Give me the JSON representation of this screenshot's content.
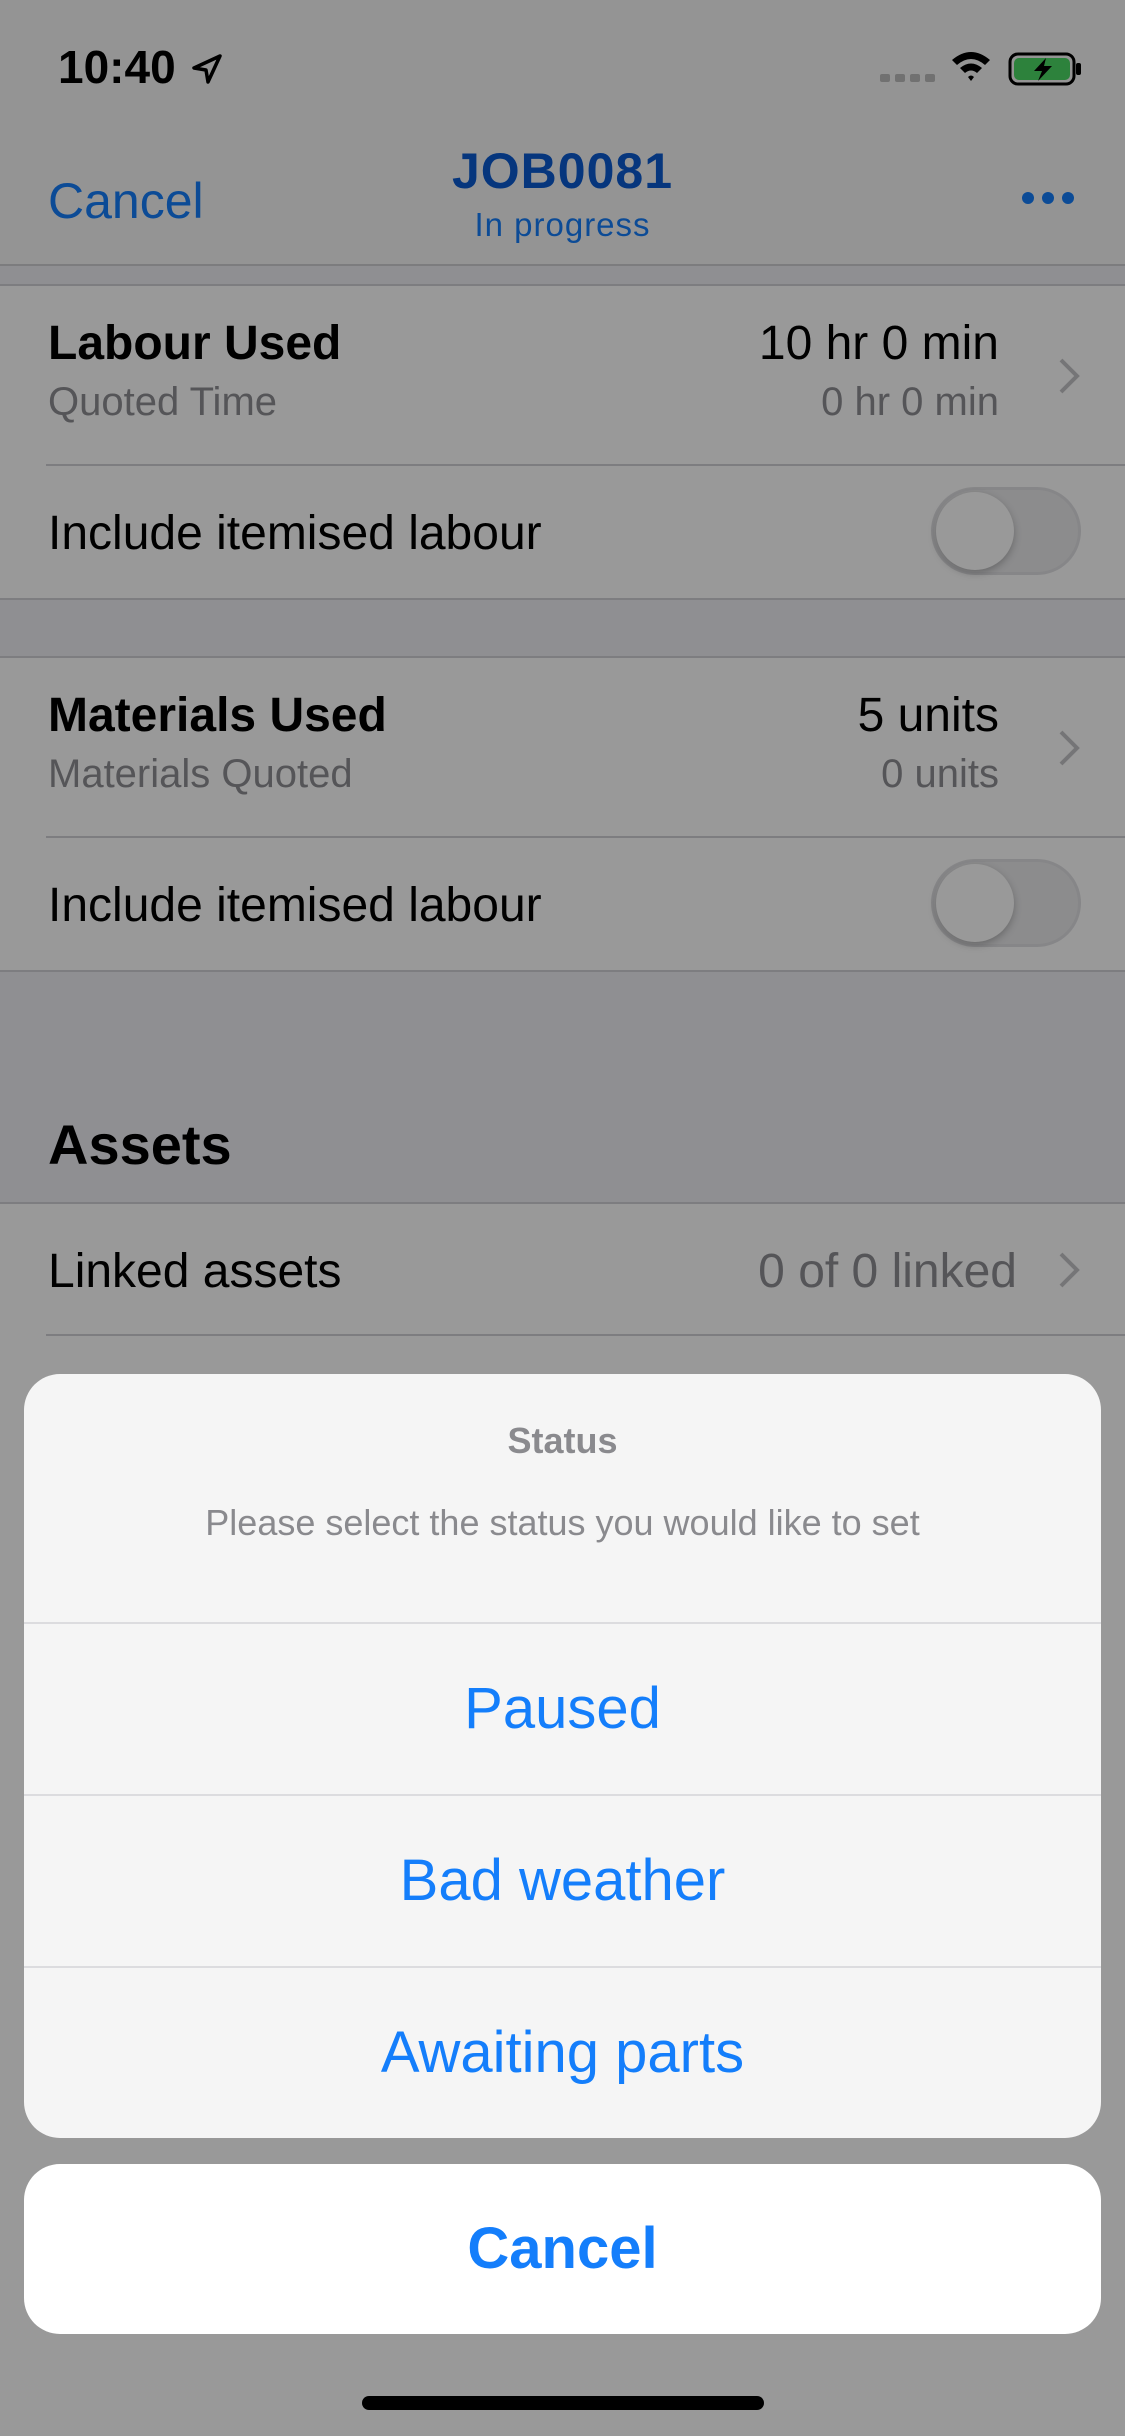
{
  "status_bar": {
    "time": "10:40",
    "icons": [
      "location-arrow-icon",
      "cellular-signal-icon",
      "wifi-icon",
      "battery-charging-icon"
    ]
  },
  "nav": {
    "cancel_label": "Cancel",
    "title": "JOB0081",
    "subtitle": "In progress",
    "more_icon": "more-dots-icon"
  },
  "labour": {
    "label": "Labour Used",
    "value": "10 hr 0 min",
    "sub_label": "Quoted Time",
    "sub_value": "0 hr 0 min",
    "itemised_label": "Include itemised labour",
    "itemised_on": false
  },
  "materials": {
    "label": "Materials Used",
    "value": "5 units",
    "sub_label": "Materials Quoted",
    "sub_value": "0 units",
    "itemised_label": "Include itemised labour",
    "itemised_on": false
  },
  "assets": {
    "header": "Assets",
    "linked_label": "Linked assets",
    "linked_value": "0 of 0 linked"
  },
  "action_sheet": {
    "title": "Status",
    "message": "Please select the status you would like to set",
    "options": [
      "Paused",
      "Bad weather",
      "Awaiting parts"
    ],
    "cancel_label": "Cancel"
  },
  "colors": {
    "accent": "#147efb",
    "title_blue": "#0b5bd1",
    "secondary_text": "#8e8e93"
  }
}
